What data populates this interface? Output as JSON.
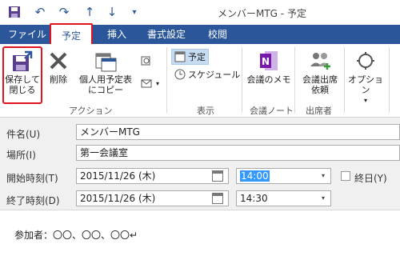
{
  "window": {
    "title": "メンバーMTG - 予定"
  },
  "quick_access": [
    "save-icon",
    "undo-icon",
    "redo-icon",
    "up-arrow-icon",
    "down-arrow-icon",
    "customize-icon"
  ],
  "tabs": {
    "file": "ファイル",
    "schedule": "予定",
    "insert": "挿入",
    "format": "書式設定",
    "review": "校閲"
  },
  "ribbon": {
    "save_close": "保存して\n閉じる",
    "delete": "削除",
    "copy_personal": "個人用予定表\nにコピー",
    "group_action": "アクション",
    "view_appointment": "予定",
    "view_schedule": "スケジュール",
    "group_view": "表示",
    "meeting_memo": "会議のメモ",
    "group_meeting_note": "会議ノート",
    "attendee": "会議出席\n依頼",
    "group_attendee": "出席者",
    "options": "オプション"
  },
  "form": {
    "subject_label": "件名(U)",
    "subject_value": "メンバーMTG",
    "location_label": "場所(I)",
    "location_value": "第一会議室",
    "start_label": "開始時刻(T)",
    "start_date": "2015/11/26 (木)",
    "start_time": "14:00",
    "allday_label": "終日(Y)",
    "end_label": "終了時刻(D)",
    "end_date": "2015/11/26 (木)",
    "end_time": "14:30"
  },
  "body": {
    "text": "参加者：〇〇、〇〇、〇〇↵"
  },
  "colors": {
    "accent": "#2b579a",
    "highlight": "#e0141e"
  }
}
